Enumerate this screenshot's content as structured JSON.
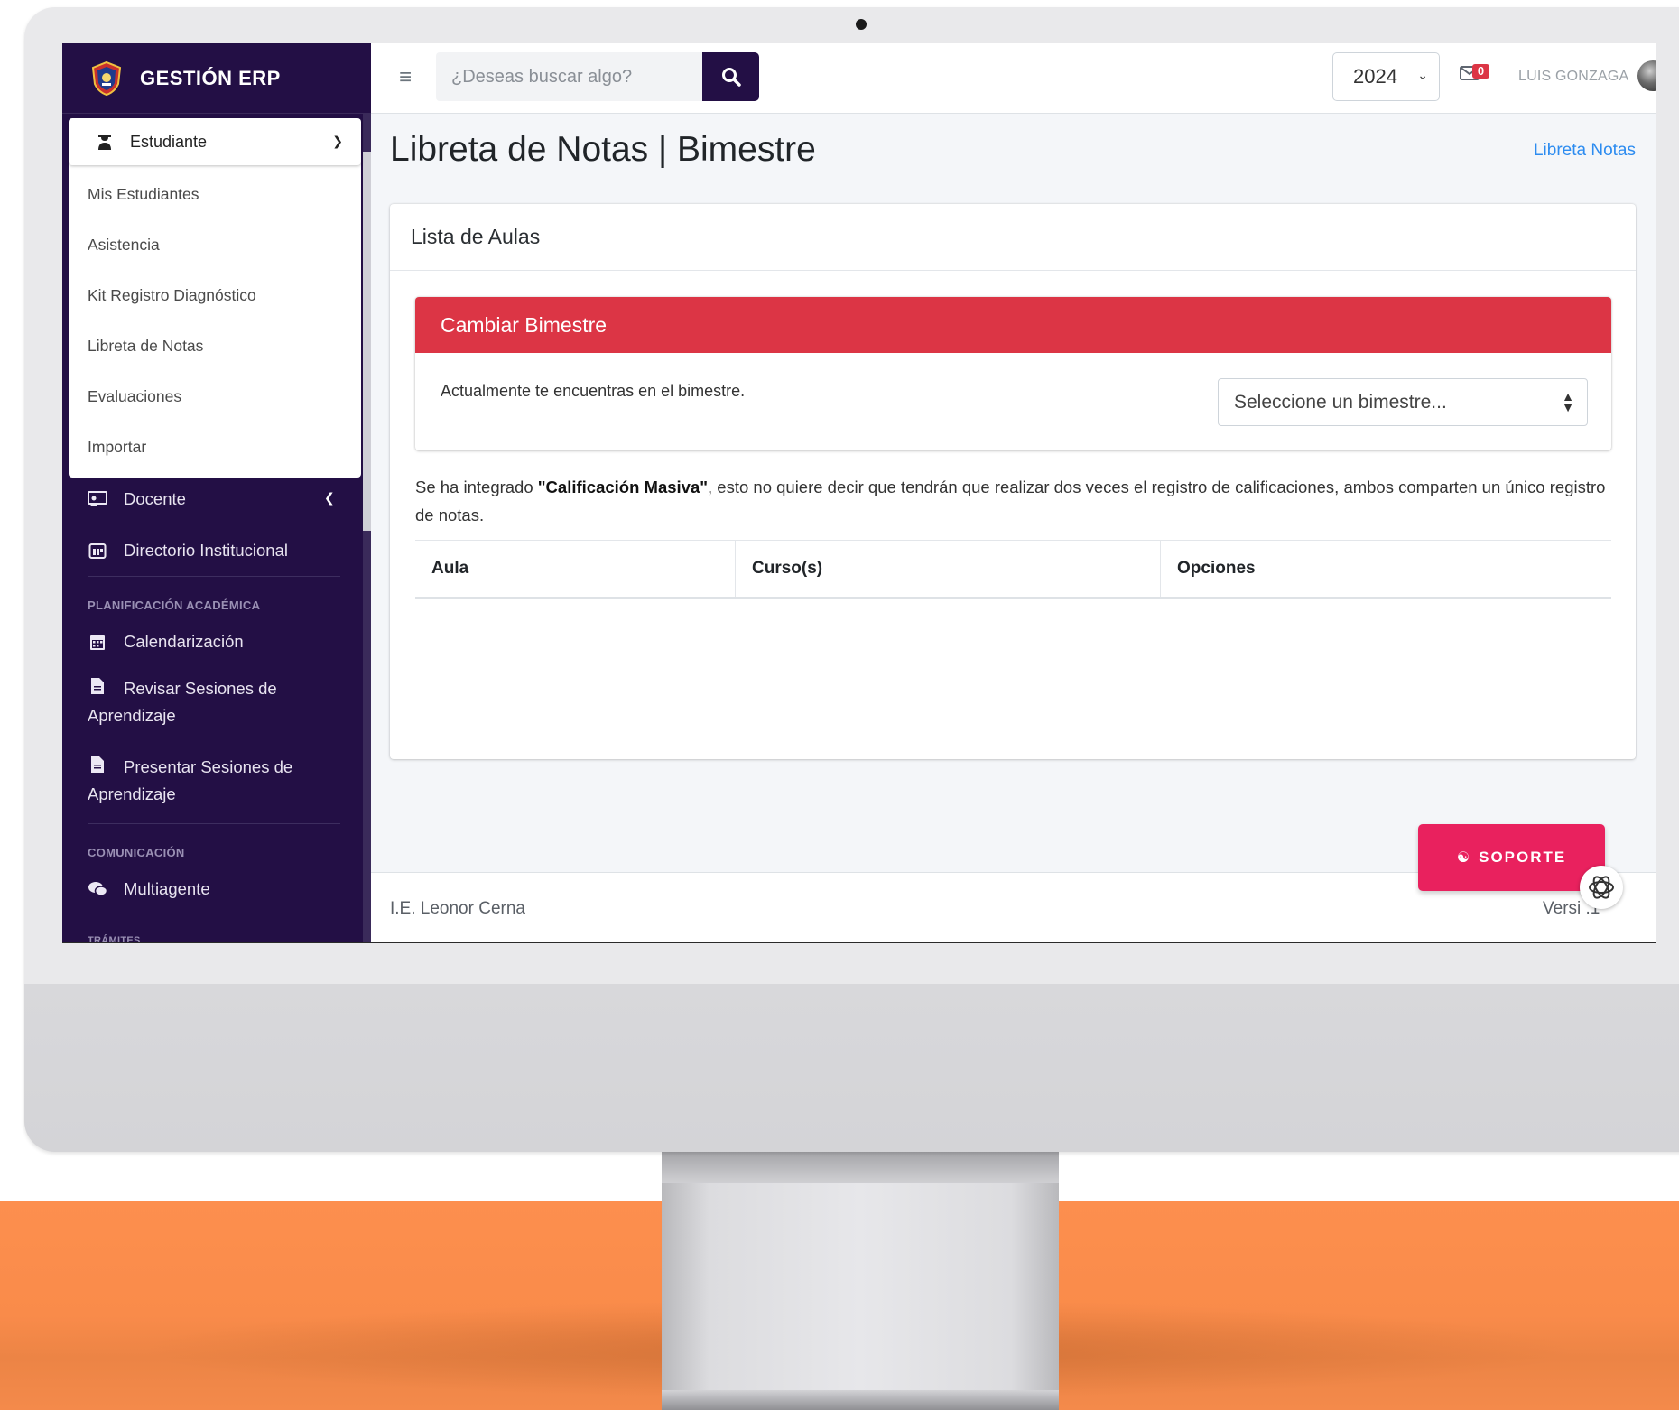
{
  "brand": {
    "name": "GESTIÓN ERP"
  },
  "sidebar": {
    "open_group": {
      "label": "Estudiante",
      "icon": "student-icon"
    },
    "sub_items": [
      {
        "label": "Mis Estudiantes"
      },
      {
        "label": "Asistencia"
      },
      {
        "label": "Kit Registro Diagnóstico"
      },
      {
        "label": "Libreta de Notas"
      },
      {
        "label": "Evaluaciones"
      },
      {
        "label": "Importar"
      }
    ],
    "docente": {
      "label": "Docente",
      "icon": "chalkboard-teacher-icon"
    },
    "directorio": {
      "label": "Directorio Institucional",
      "icon": "calendar-grid-icon"
    },
    "section_planificacion": "PLANIFICACIÓN ACADÉMICA",
    "calendarizacion": {
      "label": "Calendarización",
      "icon": "calendar-icon"
    },
    "revisar": {
      "label_line1": "Revisar Sesiones de",
      "label_line2": "Aprendizaje",
      "icon": "file-icon"
    },
    "presentar": {
      "label_line1": "Presentar Sesiones de",
      "label_line2": "Aprendizaje",
      "icon": "file-icon"
    },
    "section_comunicacion": "COMUNICACIÓN",
    "multiagente": {
      "label": "Multiagente",
      "icon": "chat-icon"
    },
    "section_tramites": "TRÁMITES"
  },
  "topbar": {
    "search_placeholder": "¿Deseas buscar algo?",
    "year": "2024",
    "mail_badge": "0",
    "username": "LUIS GONZAGA"
  },
  "page": {
    "title": "Libreta de Notas | Bimestre",
    "breadcrumb": "Libreta Notas"
  },
  "card": {
    "header": "Lista de Aulas",
    "bimestre_panel": {
      "title": "Cambiar Bimestre",
      "text": "Actualmente te encuentras en el bimestre.",
      "select_placeholder": "Seleccione un bimestre..."
    },
    "note_prefix": "Se ha integrado ",
    "note_bold": "\"Calificación Masiva\"",
    "note_suffix": ", esto no quiere decir que tendrán que realizar dos veces el registro de calificaciones, ambos comparten un único registro de notas.",
    "table_headers": [
      "Aula",
      "Curso(s)",
      "Opciones"
    ]
  },
  "support_button": "SOPORTE",
  "footer": {
    "left": "I.E. Leonor Cerna",
    "right": "Versi    .1"
  },
  "colors": {
    "sidebar_bg": "#230f45",
    "danger": "#dc3545",
    "support": "#e9215e",
    "link": "#2d8cf0",
    "floor": "#fd8f4e"
  }
}
